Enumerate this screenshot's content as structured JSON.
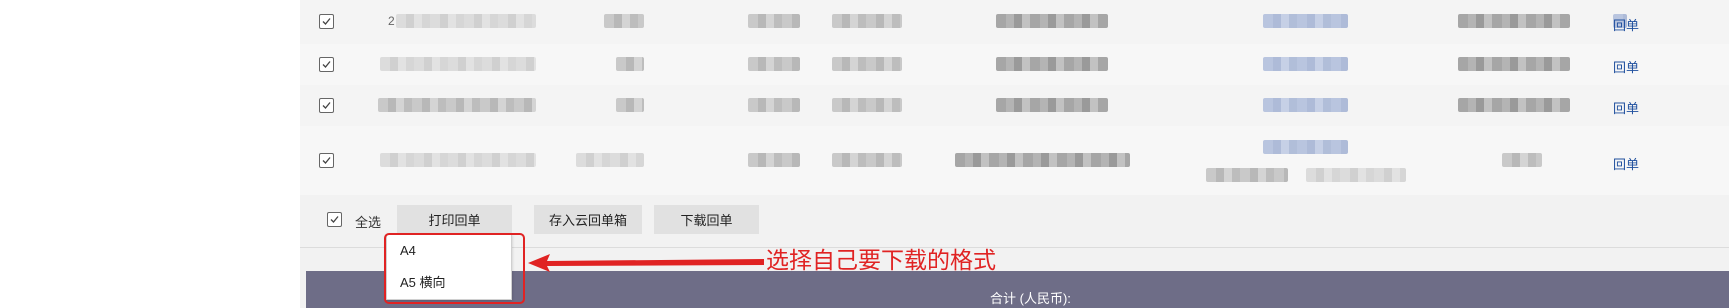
{
  "rows": [
    {
      "receipt_link": "回单"
    },
    {
      "receipt_link": "回单"
    },
    {
      "receipt_link": "回单"
    },
    {
      "receipt_link": "回单"
    }
  ],
  "toolbar": {
    "select_all_label": "全选",
    "print_button": "打印回单",
    "save_cloud_button": "存入云回单箱",
    "download_button": "下载回单"
  },
  "dropdown": {
    "options": [
      "A4",
      "A5 横向"
    ]
  },
  "footer": {
    "total_label": "合计 (人民币):"
  },
  "annotation": {
    "text": "选择自己要下载的格式",
    "color": "#e02323"
  },
  "colors": {
    "link": "#1f4f9e",
    "footer_bg": "#6e6d87",
    "button_bg": "#e1e1e1"
  },
  "icons": [
    "checkbox-checked-icon",
    "arrow-left-icon"
  ]
}
